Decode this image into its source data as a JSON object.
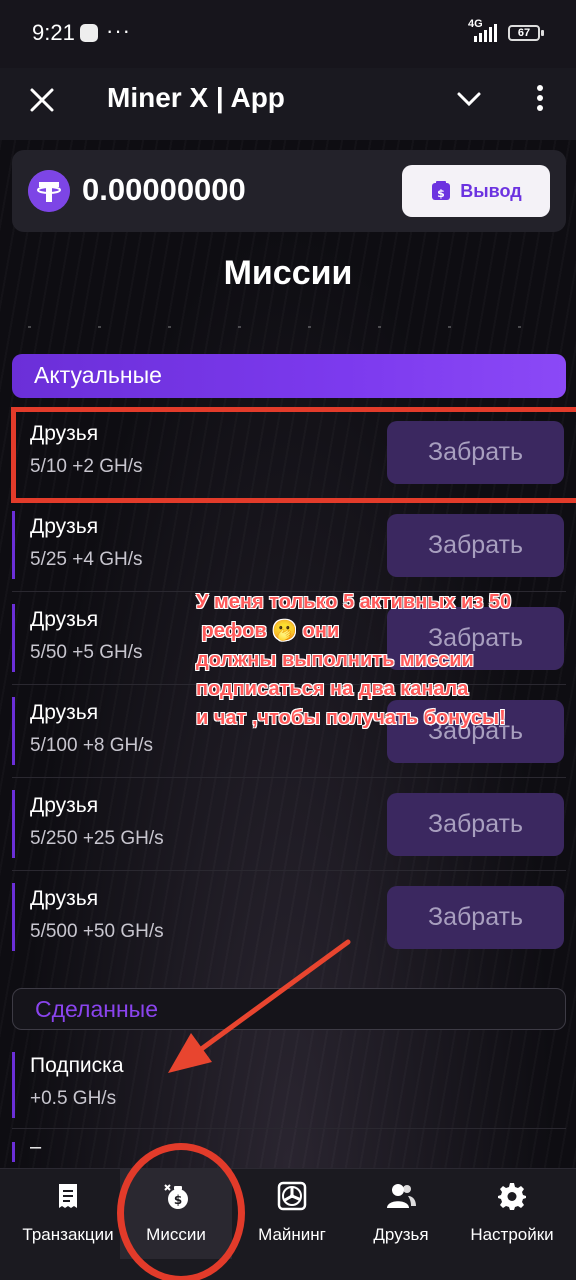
{
  "status_bar": {
    "time": "9:21",
    "more": "···",
    "network": "4G",
    "battery": "67"
  },
  "app_bar": {
    "title": "Miner X | App"
  },
  "balance": {
    "amount": "0.00000000",
    "withdraw_label": "Вывод"
  },
  "page_title": "Миссии",
  "sections": {
    "active_label": "Актуальные",
    "done_label": "Сделанные"
  },
  "missions": [
    {
      "name": "Друзья",
      "reward": "5/10 +2 GH/s",
      "button": "Забрать"
    },
    {
      "name": "Друзья",
      "reward": "5/25 +4 GH/s",
      "button": "Забрать"
    },
    {
      "name": "Друзья",
      "reward": "5/50 +5 GH/s",
      "button": "Забрать"
    },
    {
      "name": "Друзья",
      "reward": "5/100 +8 GH/s",
      "button": "Забрать"
    },
    {
      "name": "Друзья",
      "reward": "5/250 +25 GH/s",
      "button": "Забрать"
    },
    {
      "name": "Друзья",
      "reward": "5/500 +50 GH/s",
      "button": "Забрать"
    }
  ],
  "done": [
    {
      "name": "Подписка",
      "reward": "+0.5 GH/s"
    }
  ],
  "next_partial": "–",
  "annotation": "У меня только 5 активных из 50\n рефов 🫢 они\nдолжны выполнить миссии\nподписаться на два канала\nи чат ,чтобы получать бонусы!",
  "bottom_nav": [
    {
      "label": "Транзакции",
      "icon": "receipt-icon"
    },
    {
      "label": "Миссии",
      "icon": "money-bag-icon"
    },
    {
      "label": "Майнинг",
      "icon": "fan-icon"
    },
    {
      "label": "Друзья",
      "icon": "users-icon"
    },
    {
      "label": "Настройки",
      "icon": "gear-icon"
    }
  ],
  "colors": {
    "accent": "#7c3aee",
    "annotation": "#e23b2a",
    "background": "#0d0c10"
  }
}
